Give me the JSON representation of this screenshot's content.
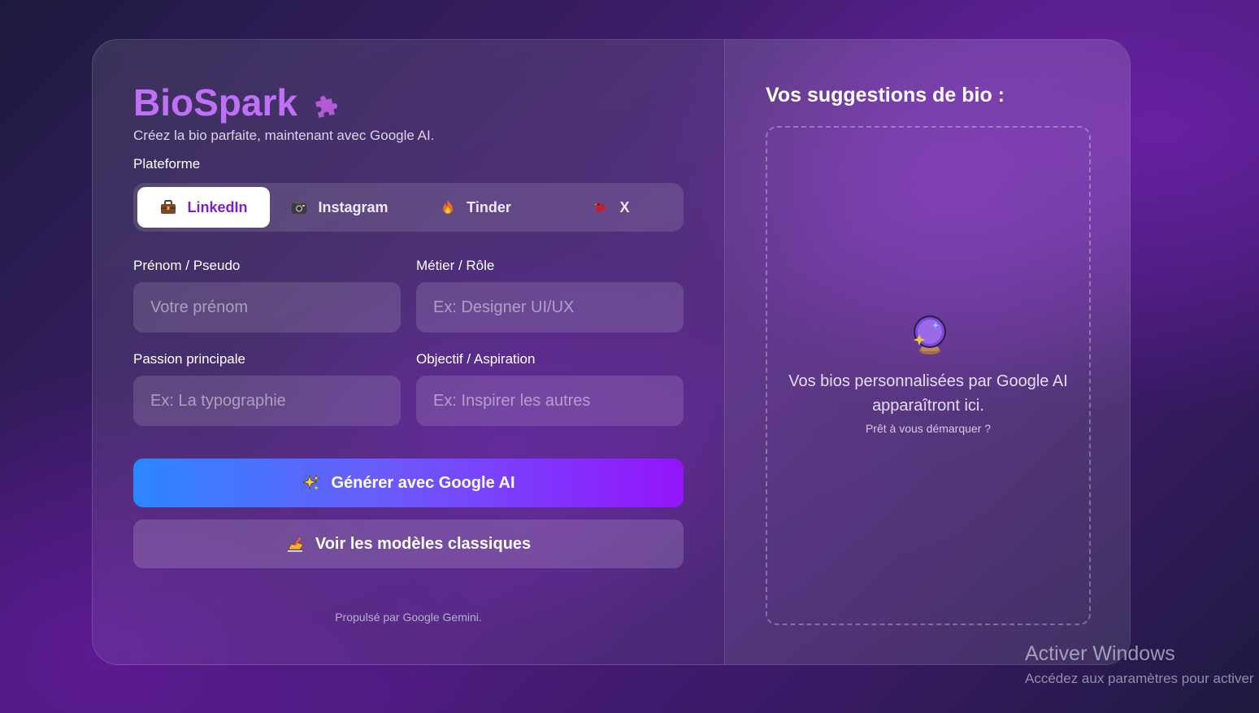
{
  "app": {
    "title": "BioSpark",
    "subtitle": "Créez la bio parfaite, maintenant avec Google AI.",
    "title_icon": "puzzle-piece-icon",
    "accent_color": "#c070f5"
  },
  "platform": {
    "label": "Plateforme",
    "selected": "LinkedIn",
    "options": [
      {
        "label": "LinkedIn",
        "icon": "briefcase-icon"
      },
      {
        "label": "Instagram",
        "icon": "camera-icon"
      },
      {
        "label": "Tinder",
        "icon": "fire-icon"
      },
      {
        "label": "X",
        "icon": "bird-icon"
      }
    ]
  },
  "form": {
    "first_name": {
      "label": "Prénom / Pseudo",
      "placeholder": "Votre prénom",
      "value": ""
    },
    "job": {
      "label": "Métier / Rôle",
      "placeholder": "Ex: Designer UI/UX",
      "value": ""
    },
    "passion": {
      "label": "Passion principale",
      "placeholder": "Ex: La typographie",
      "value": ""
    },
    "goal": {
      "label": "Objectif / Aspiration",
      "placeholder": "Ex: Inspirer les autres",
      "value": ""
    }
  },
  "actions": {
    "generate_label": "Générer avec Google AI",
    "generate_icon": "sparkles-icon",
    "models_label": "Voir les modèles classiques",
    "models_icon": "writing-hand-icon"
  },
  "footer": "Propulsé par Google Gemini.",
  "suggestions": {
    "title": "Vos suggestions de bio :",
    "icon": "crystal-ball-icon",
    "empty_text": "Vos bios personnalisées par Google AI apparaîtront ici.",
    "empty_subtext": "Prêt à vous démarquer ?"
  },
  "windows_watermark": {
    "title": "Activer Windows",
    "subtitle": "Accédez aux paramètres pour activer"
  }
}
